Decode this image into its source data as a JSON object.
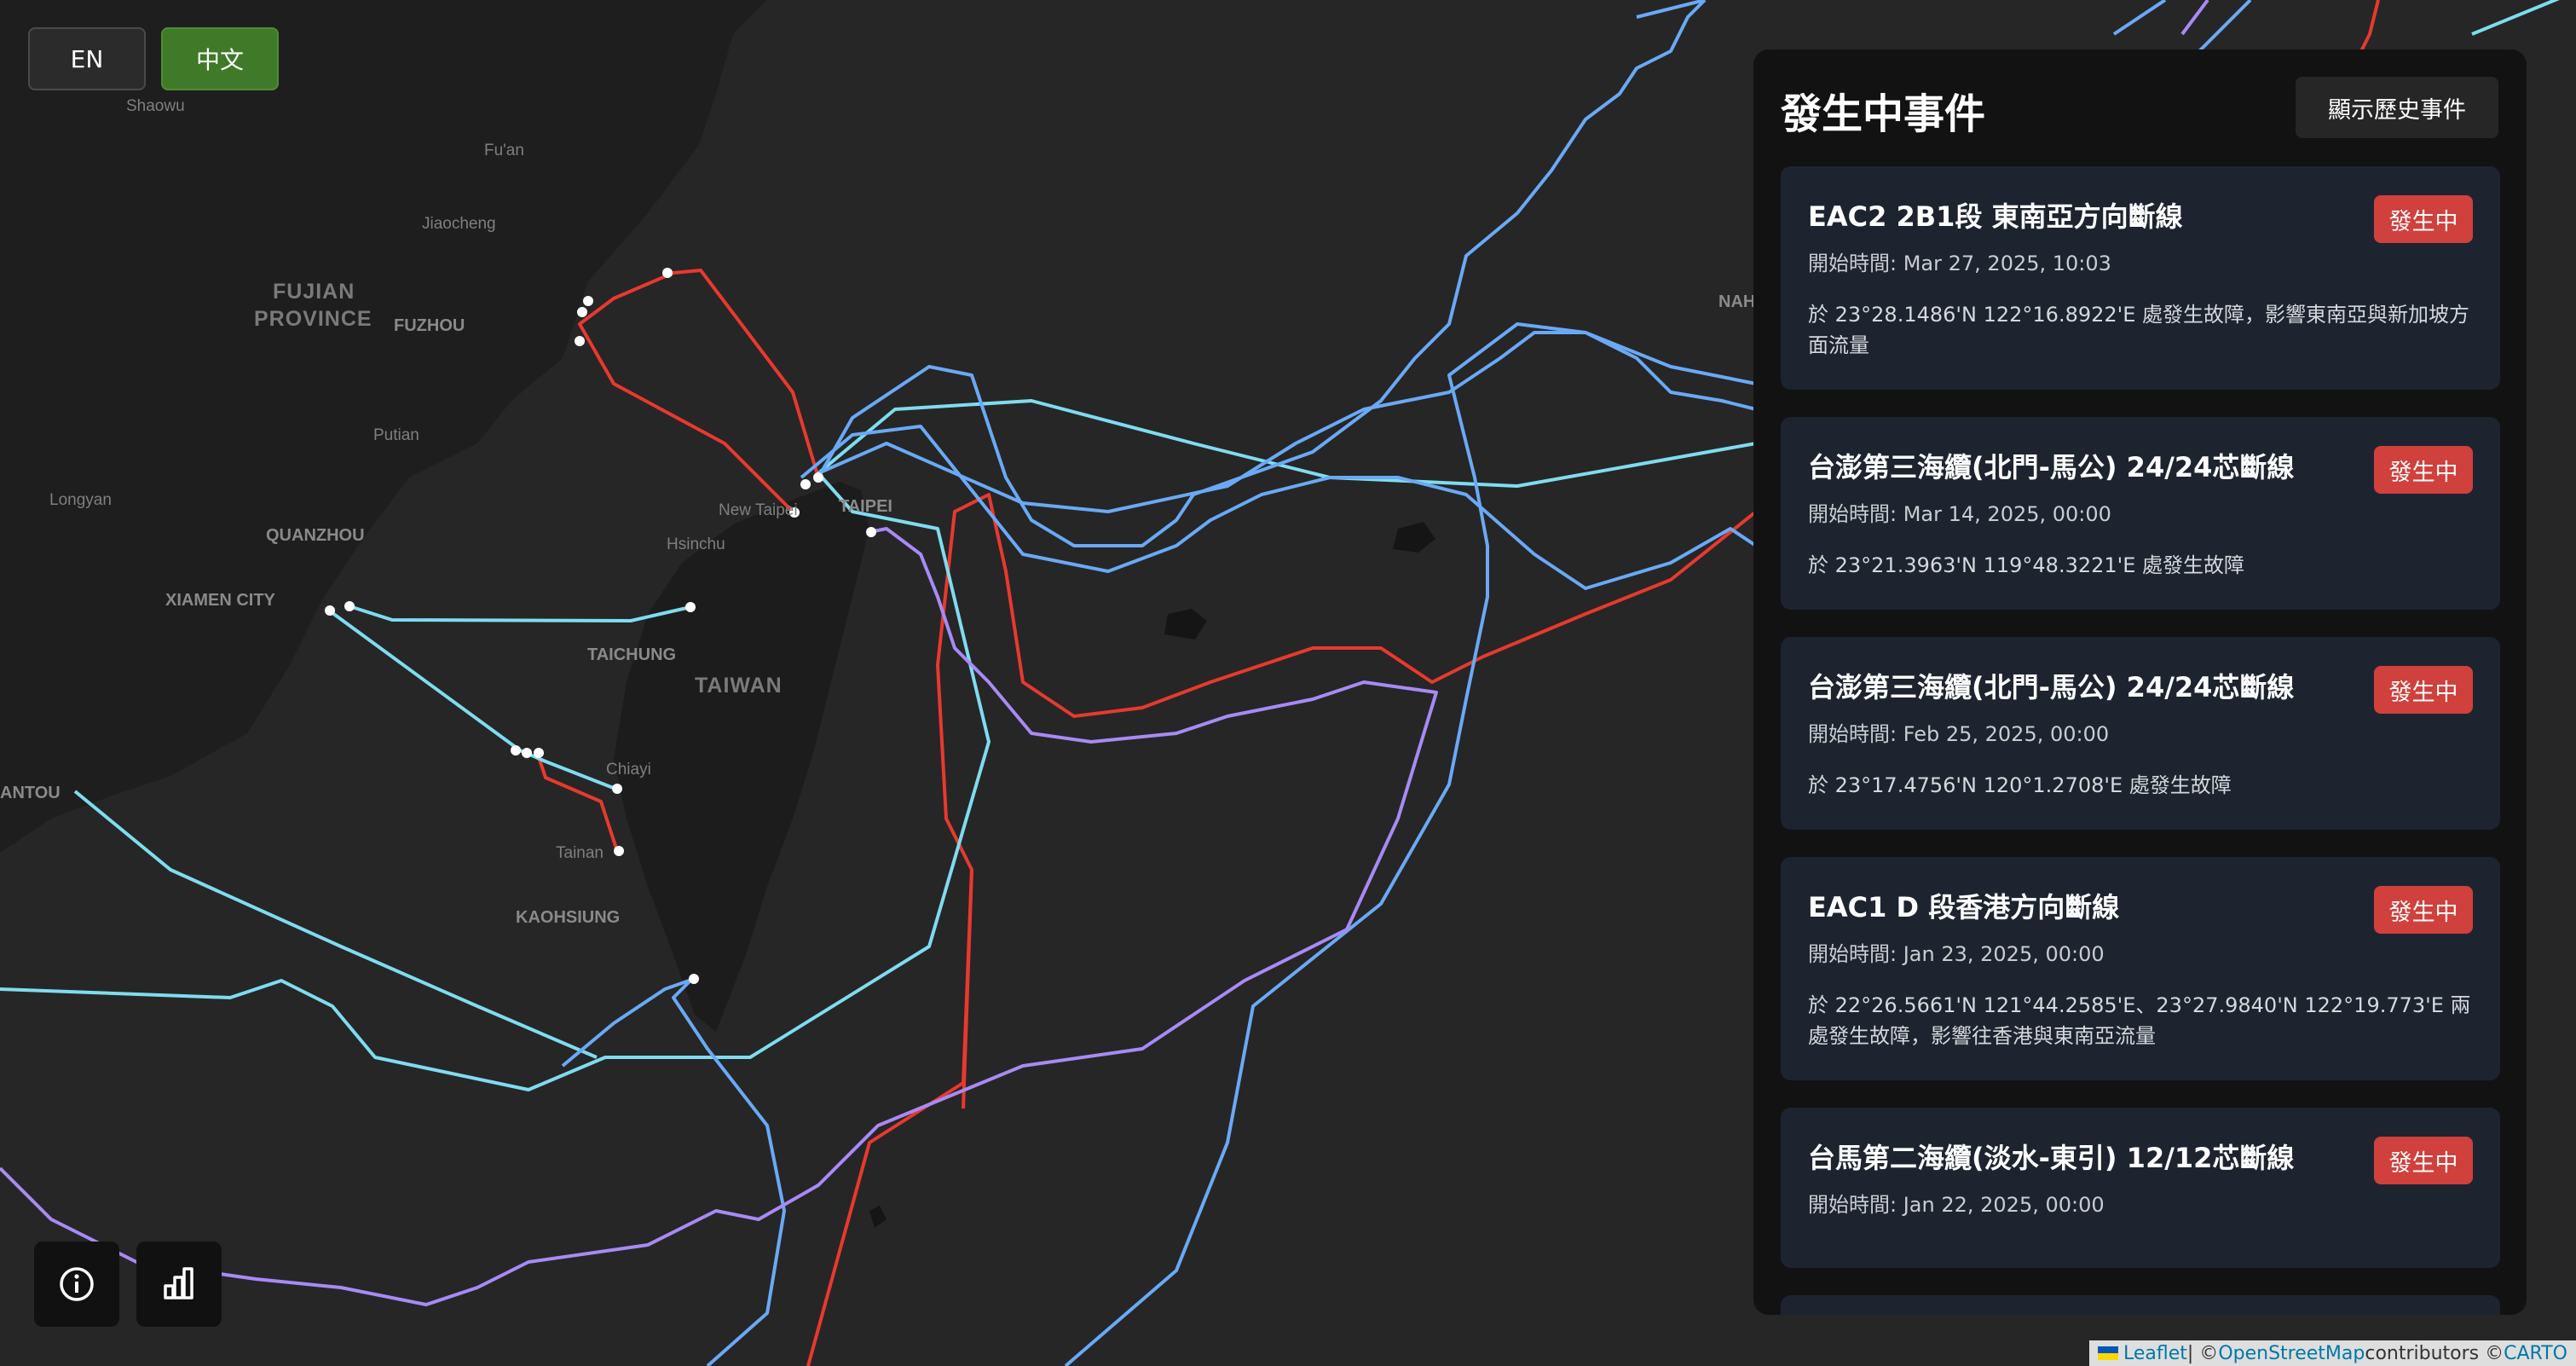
{
  "language": {
    "en_label": "EN",
    "zh_label": "中文",
    "active": "中文"
  },
  "map": {
    "labels": {
      "shaowu": "Shaowu",
      "fuan": "Fu'an",
      "jiaocheng": "Jiaocheng",
      "fujian_line1": "FUJIAN",
      "fujian_line2": "PROVINCE",
      "fuzhou": "FUZHOU",
      "putian": "Putian",
      "longyan": "Longyan",
      "quanzhou": "QUANZHOU",
      "xiamen": "XIAMEN CITY",
      "new_taipei": "New Taipei",
      "taipei": "TAIPEI",
      "hsinchu": "Hsinchu",
      "taichung": "TAICHUNG",
      "taiwan": "TAIWAN",
      "chiayi": "Chiayi",
      "tainan": "Tainan",
      "kaohsiung": "KAOHSIUNG",
      "shantou": "ANTOU",
      "nah": "NAH"
    },
    "cable_colors": {
      "active_fault": "#e8392f",
      "cyan": "#7fdcef",
      "blue": "#6aa9f5",
      "purple": "#a88af5"
    }
  },
  "panel": {
    "title": "發生中事件",
    "history_button": "顯示歷史事件",
    "events": [
      {
        "title": "EAC2 2B1段 東南亞方向斷線",
        "status": "發生中",
        "time": "開始時間: Mar 27, 2025, 10:03",
        "description": "於 23°28.1486'N 122°16.8922'E 處發生故障，影響東南亞與新加坡方面流量"
      },
      {
        "title": "台澎第三海纜(北門-馬公) 24/24芯斷線",
        "status": "發生中",
        "time": "開始時間: Mar 14, 2025, 00:00",
        "description": "於 23°21.3963'N 119°48.3221'E 處發生故障"
      },
      {
        "title": "台澎第三海纜(北門-馬公) 24/24芯斷線",
        "status": "發生中",
        "time": "開始時間: Feb 25, 2025, 00:00",
        "description": "於 23°17.4756'N 120°1.2708'E 處發生故障"
      },
      {
        "title": "EAC1 D 段香港方向斷線",
        "status": "發生中",
        "time": "開始時間: Jan 23, 2025, 00:00",
        "description": "於 22°26.5661'N 121°44.2585'E、23°27.9840'N 122°19.773'E 兩處發生故障，影響往香港與東南亞流量"
      },
      {
        "title": "台馬第二海纜(淡水-東引) 12/12芯斷線",
        "status": "發生中",
        "time": "開始時間: Jan 22, 2025, 00:00",
        "description": ""
      }
    ]
  },
  "tools": {
    "info_icon": "info-icon",
    "stats_icon": "bar-chart-icon"
  },
  "attribution": {
    "leaflet": "Leaflet",
    "sep1": " | © ",
    "osm": "OpenStreetMap",
    "mid": " contributors © ",
    "carto": "CARTO"
  }
}
